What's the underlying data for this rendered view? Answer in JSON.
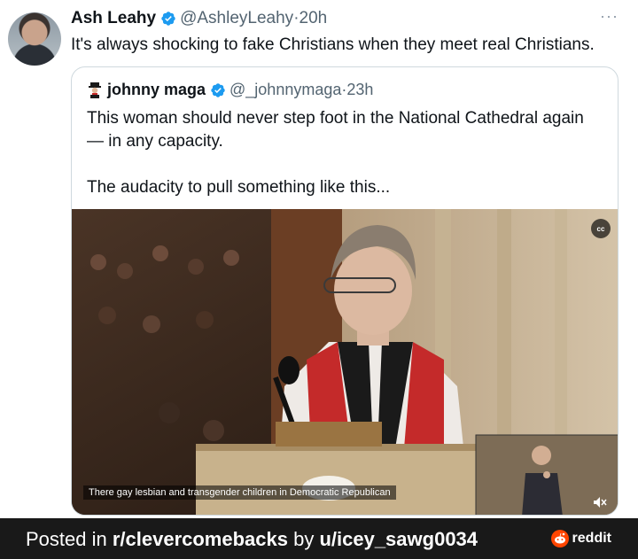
{
  "tweet": {
    "author_name": "Ash Leahy",
    "handle": "@AshleyLeahy",
    "dot": "·",
    "time": "20h",
    "more_icon": "ellipsis-icon",
    "text": "It's always shocking to fake Christians when they meet real Christians."
  },
  "quote": {
    "author_name": "johnny maga",
    "handle": "@_johnnymaga",
    "dot": "·",
    "time": "23h",
    "text": "This woman should never step foot in the National Cathedral again\n— in any capacity.\n\nThe audacity to pull something like this...",
    "video": {
      "cc_label": "cc",
      "caption": "There gay lesbian and transgender children in Democratic Republican",
      "volume_icon": "speaker-muted-icon"
    }
  },
  "footer": {
    "posted_prefix": "Posted in ",
    "subreddit": "r/clevercomebacks",
    "by": " by ",
    "user": "u/icey_sawg0034",
    "brand": "reddit"
  },
  "colors": {
    "verified": "#1d9bf0",
    "footer_bg": "#191919",
    "reddit_orange": "#ff4500",
    "muted_text": "#536471"
  }
}
